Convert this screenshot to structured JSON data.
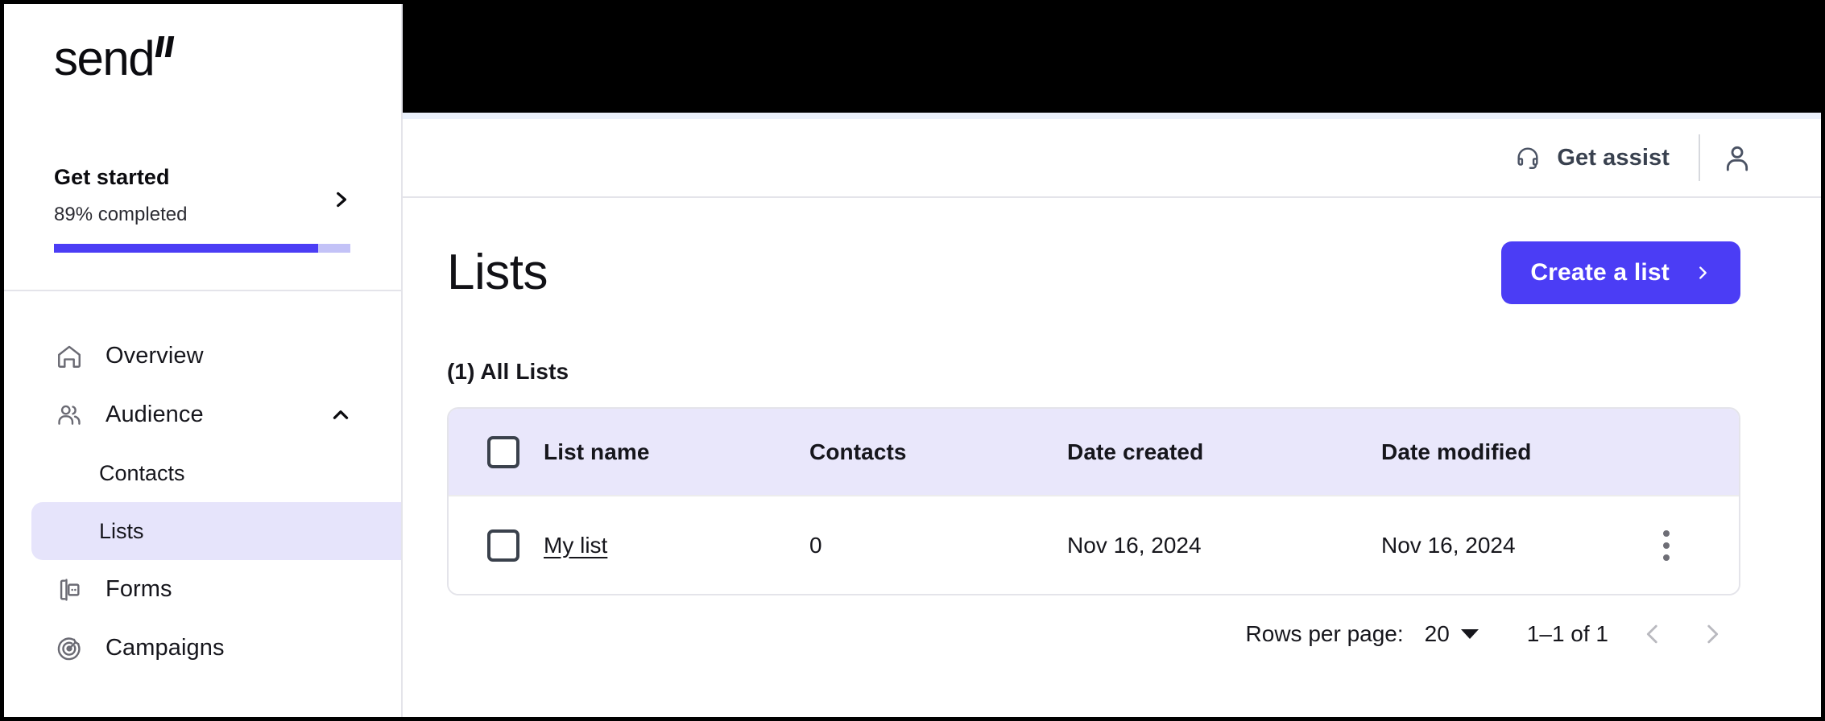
{
  "brand": {
    "name": "send"
  },
  "sidebar": {
    "get_started": {
      "title": "Get started",
      "progress_text": "89% completed",
      "progress_percent": 89,
      "accent_color": "#4b3df5",
      "track_color": "#c3c2f7"
    },
    "nav": [
      {
        "label": "Overview",
        "icon": "home-icon"
      },
      {
        "label": "Audience",
        "icon": "users-icon",
        "caret": "chevron-up-icon"
      }
    ],
    "sub_items": [
      {
        "label": "Contacts",
        "active": false
      },
      {
        "label": "Lists",
        "active": true
      }
    ],
    "nav_bottom": [
      {
        "label": "Forms",
        "icon": "form-icon"
      },
      {
        "label": "Campaigns",
        "icon": "target-icon"
      }
    ]
  },
  "topbar": {
    "assist_label": "Get assist",
    "assist_icon": "headset-icon",
    "avatar_icon": "user-avatar-icon"
  },
  "page": {
    "title": "Lists",
    "create_button": "Create a list",
    "section_label": "(1) All Lists"
  },
  "table": {
    "columns": [
      "List name",
      "Contacts",
      "Date created",
      "Date modified"
    ],
    "rows": [
      {
        "name": "My list",
        "contacts": "0",
        "date_created": "Nov 16, 2024",
        "date_modified": "Nov 16, 2024"
      }
    ]
  },
  "pagination": {
    "rows_per_page_label": "Rows per page:",
    "rows_per_page_value": "20",
    "range": "1–1 of 1",
    "prev_icon": "chevron-left-icon",
    "next_icon": "chevron-right-icon"
  }
}
